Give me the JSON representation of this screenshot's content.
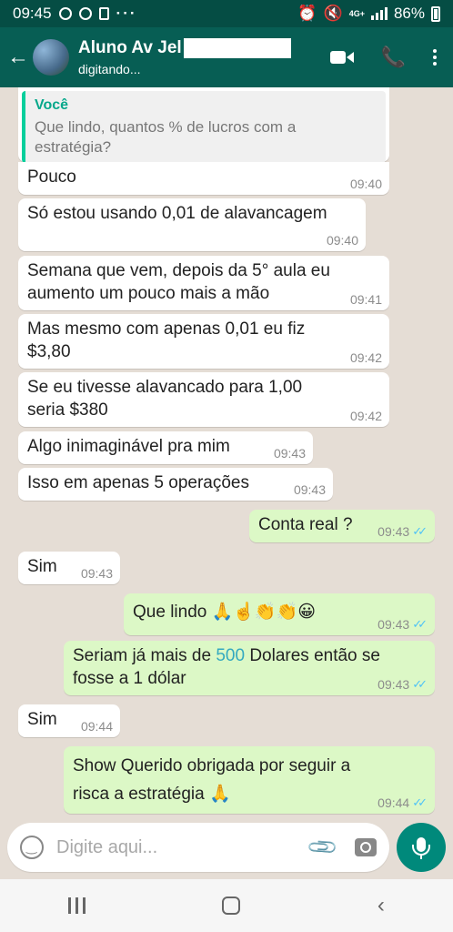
{
  "status_bar": {
    "time": "09:45",
    "net_label": "4G+",
    "battery": "86%"
  },
  "header": {
    "contact_name": "Aluno Av Jel",
    "status": "digitando..."
  },
  "quoted": {
    "author": "Você",
    "text": "Que lindo, quantos % de lucros com a estratégia?"
  },
  "messages": [
    {
      "dir": "in",
      "text": "Pouco",
      "time": "09:40"
    },
    {
      "dir": "in",
      "text": "Só estou usando 0,01 de alavancagem",
      "time": "09:40"
    },
    {
      "dir": "in",
      "text": "Semana que vem, depois da 5° aula eu aumento um pouco mais a mão",
      "time": "09:41"
    },
    {
      "dir": "in",
      "text": "Mas mesmo com apenas 0,01 eu fiz $3,80",
      "time": "09:42"
    },
    {
      "dir": "in",
      "text": "Se eu tivesse alavancado para 1,00 seria $380",
      "time": "09:42"
    },
    {
      "dir": "in",
      "text": "Algo inimaginável pra mim",
      "time": "09:43"
    },
    {
      "dir": "in",
      "text": "Isso em apenas 5 operações",
      "time": "09:43"
    },
    {
      "dir": "out",
      "text": "Conta real ?",
      "time": "09:43"
    },
    {
      "dir": "in",
      "text": "Sim",
      "time": "09:43"
    },
    {
      "dir": "out",
      "text": "Que lindo 🙏☝️👏👏😀",
      "time": "09:43"
    },
    {
      "dir": "out",
      "text_before": "Seriam já mais de ",
      "highlight": "500",
      "text_after": " Dolares então se fosse a 1 dólar",
      "time": "09:43"
    },
    {
      "dir": "in",
      "text": "Sim",
      "time": "09:44"
    },
    {
      "dir": "out",
      "text": "Show Querido obrigada por seguir a risca a estratégia 🙏",
      "time": "09:44"
    }
  ],
  "composer": {
    "placeholder": "Digite aqui..."
  },
  "icons": {
    "back": "arrow-left",
    "video": "video-camera",
    "call": "phone",
    "menu": "more-vertical",
    "emoji": "emoji-face",
    "attach": "paperclip",
    "camera": "camera",
    "mic": "microphone",
    "read_receipt": "double-check-blue"
  },
  "colors": {
    "header": "#075e54",
    "outgoing": "#dcf8c6",
    "incoming": "#ffffff",
    "accent": "#00897b",
    "ticks": "#4fc3f7"
  }
}
